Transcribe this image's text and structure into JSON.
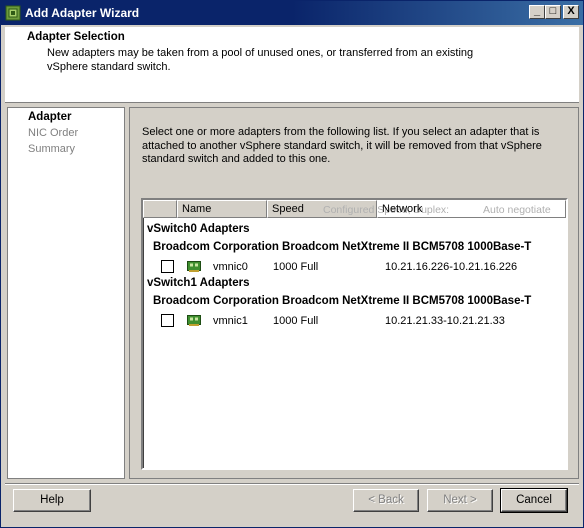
{
  "window": {
    "title": "Add Adapter Wizard"
  },
  "titlebar_buttons": [
    "_",
    "□",
    "X"
  ],
  "header": {
    "title": "Adapter Selection",
    "description": "New adapters may be taken from a pool of unused ones, or transferred from an existing vSphere standard switch."
  },
  "nav": {
    "items": [
      {
        "label": "Adapter",
        "active": true
      },
      {
        "label": "NIC Order",
        "active": false
      },
      {
        "label": "Summary",
        "active": false
      }
    ]
  },
  "intro_text": "Select one or more adapters from the following list. If you select an adapter that is attached to another vSphere standard switch, it will be removed from that vSphere standard switch and added to this one.",
  "table": {
    "columns": [
      "Name",
      "Speed",
      "Network"
    ],
    "ghost_text": [
      "Configured Speed, Duplex:",
      "Auto negotiate"
    ],
    "groups": [
      {
        "title": "vSwitch0 Adapters",
        "vendor": "Broadcom Corporation Broadcom NetXtreme II BCM5708 1000Base-T",
        "rows": [
          {
            "name": "vmnic0",
            "speed": "1000 Full",
            "network": "10.21.16.226-10.21.16.226"
          }
        ]
      },
      {
        "title": "vSwitch1 Adapters",
        "vendor": "Broadcom Corporation Broadcom NetXtreme II BCM5708 1000Base-T",
        "rows": [
          {
            "name": "vmnic1",
            "speed": "1000 Full",
            "network": "10.21.21.33-10.21.21.33"
          }
        ]
      }
    ]
  },
  "buttons": {
    "help": "Help",
    "back": "< Back",
    "next": "Next >",
    "cancel": "Cancel"
  }
}
